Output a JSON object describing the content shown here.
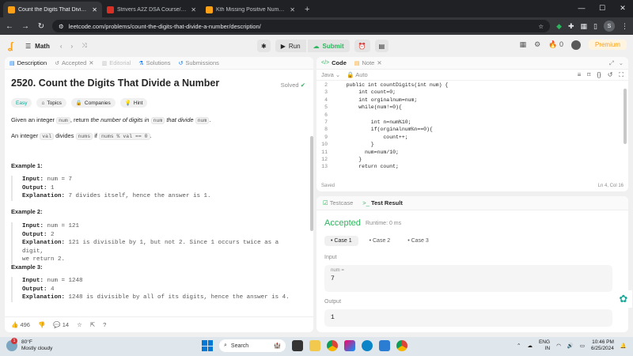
{
  "browser": {
    "tabs": [
      {
        "title": "Count the Digits That Divide a Nu",
        "favicon_color": "#ffa116",
        "active": true
      },
      {
        "title": "Strivers A2Z DSA Course/Sheet",
        "favicon_color": "#d93025",
        "active": false
      },
      {
        "title": "Kth Missing Positive Number - L",
        "favicon_color": "#ffa116",
        "active": false
      }
    ],
    "new_tab": "+",
    "url": "leetcode.com/problems/count-the-digits-that-divide-a-number/description/",
    "profile_initial": "S"
  },
  "header": {
    "problem_list_label": "Math",
    "run_label": "Run",
    "submit_label": "Submit",
    "coins": "0",
    "premium_label": "Premium"
  },
  "left": {
    "tabs": [
      "Description",
      "Accepted",
      "Editorial",
      "Solutions",
      "Submissions"
    ],
    "title": "2520. Count the Digits That Divide a Number",
    "solved_label": "Solved",
    "chips": [
      "Easy",
      "Topics",
      "Companies",
      "Hint"
    ],
    "para1": {
      "a": "Given an integer ",
      "c1": "num",
      "b": ", return ",
      "em": "the number of digits in ",
      "c2": "num",
      "em2": " that divide ",
      "c3": "num",
      "d": "."
    },
    "para2": {
      "a": "An integer ",
      "c1": "val",
      "b": " divides ",
      "c2": "nums",
      "c": " if ",
      "c3": "nums % val == 0",
      "d": "."
    },
    "examples": [
      {
        "heading": "Example 1:",
        "input": "num = 7",
        "output": "1",
        "explanation": "7 divides itself, hence the answer is 1."
      },
      {
        "heading": "Example 2:",
        "input": "num = 121",
        "output": "2",
        "explanation": "121 is divisible by 1, but not 2. Since 1 occurs twice as a digit,",
        "explanation2": "we return 2."
      },
      {
        "heading": "Example 3:",
        "input": "num = 1248",
        "output": "4",
        "explanation": "1248 is divisible by all of its digits, hence the answer is 4."
      }
    ],
    "labels": {
      "input": "Input:",
      "output": "Output:",
      "explanation": "Explanation:"
    },
    "footer": {
      "likes": "496",
      "comments": "14"
    }
  },
  "code": {
    "tabs": [
      "Code",
      "Note"
    ],
    "language": "Java",
    "mode": "Auto",
    "lines": [
      {
        "n": "2",
        "t": "    public int countDigits(int num) {"
      },
      {
        "n": "3",
        "t": "        int count=0;"
      },
      {
        "n": "4",
        "t": "        int orginalnum=num;"
      },
      {
        "n": "5",
        "t": "        while(num!=0){"
      },
      {
        "n": "6",
        "t": ""
      },
      {
        "n": "7",
        "t": "            int n=num%10;"
      },
      {
        "n": "8",
        "t": "            if(orginalnum%n==0){"
      },
      {
        "n": "9",
        "t": "                count++;"
      },
      {
        "n": "10",
        "t": "            }"
      },
      {
        "n": "11",
        "t": "          num=num/10;"
      },
      {
        "n": "12",
        "t": "        }"
      },
      {
        "n": "13",
        "t": "        return count;"
      }
    ],
    "status": "Saved",
    "cursor": "Ln 4, Col 16"
  },
  "test": {
    "tabs": [
      "Testcase",
      "Test Result"
    ],
    "result": "Accepted",
    "runtime": "Runtime: 0 ms",
    "cases": [
      "Case 1",
      "Case 2",
      "Case 3"
    ],
    "input_label": "Input",
    "var_name": "num =",
    "var_value": "7",
    "output_label": "Output",
    "output_value": "1"
  },
  "taskbar": {
    "temp": "80°F",
    "weather": "Mostly cloudy",
    "weather_badge": "1",
    "search": "Search",
    "lang": "ENG",
    "region": "IN",
    "time": "10:46 PM",
    "date": "6/25/2024"
  }
}
